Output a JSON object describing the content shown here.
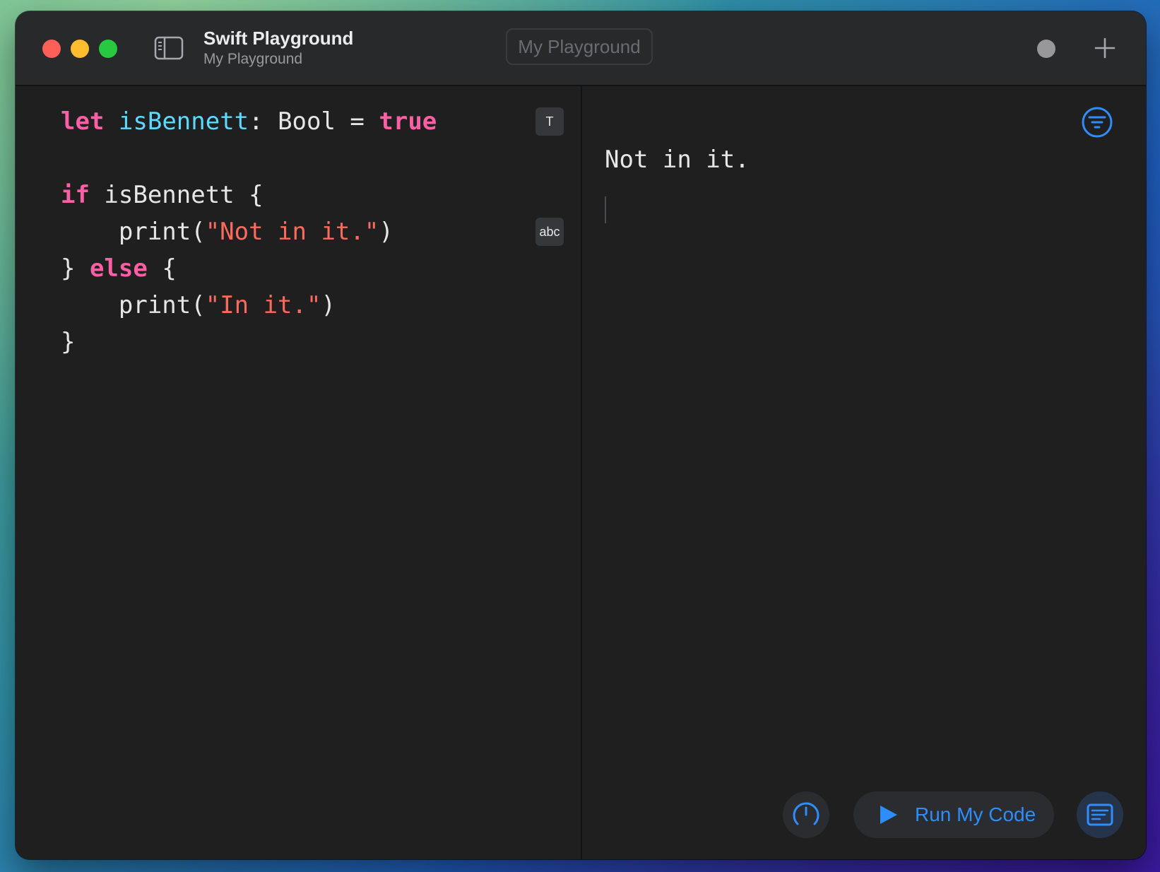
{
  "window": {
    "title": "Swift Playground",
    "subtitle": "My Playground",
    "filename_placeholder": "My Playground"
  },
  "editor": {
    "lines": [
      [
        {
          "t": "let",
          "c": "kw"
        },
        {
          "t": " ",
          "c": ""
        },
        {
          "t": "isBennett",
          "c": "id"
        },
        {
          "t": ": Bool = ",
          "c": ""
        },
        {
          "t": "true",
          "c": "kw"
        }
      ],
      [],
      [
        {
          "t": "if",
          "c": "kw"
        },
        {
          "t": " isBennett {",
          "c": ""
        }
      ],
      [
        {
          "t": "    print(",
          "c": ""
        },
        {
          "t": "\"Not in it.\"",
          "c": "str"
        },
        {
          "t": ")",
          "c": ""
        }
      ],
      [
        {
          "t": "} ",
          "c": ""
        },
        {
          "t": "else",
          "c": "kw"
        },
        {
          "t": " {",
          "c": ""
        }
      ],
      [
        {
          "t": "    print(",
          "c": ""
        },
        {
          "t": "\"In it.\"",
          "c": "str"
        },
        {
          "t": ")",
          "c": ""
        }
      ],
      [
        {
          "t": "}",
          "c": ""
        }
      ]
    ],
    "badges": [
      {
        "text": "T",
        "line": 0
      },
      {
        "text": "abc",
        "line": 3
      }
    ]
  },
  "console": {
    "output": "Not in it."
  },
  "toolbar": {
    "run_label": "Run My Code"
  },
  "colors": {
    "accent": "#2f8cfb",
    "keyword": "#fc5fa3",
    "identifier": "#5dd8ff",
    "string": "#fc6a5d"
  },
  "icons": {
    "sidebar": "sidebar-toggle-icon",
    "record": "record-dot-icon",
    "add": "plus-icon",
    "filter": "filter-icon",
    "timer": "speedometer-icon",
    "play": "play-icon",
    "log": "console-log-icon"
  }
}
